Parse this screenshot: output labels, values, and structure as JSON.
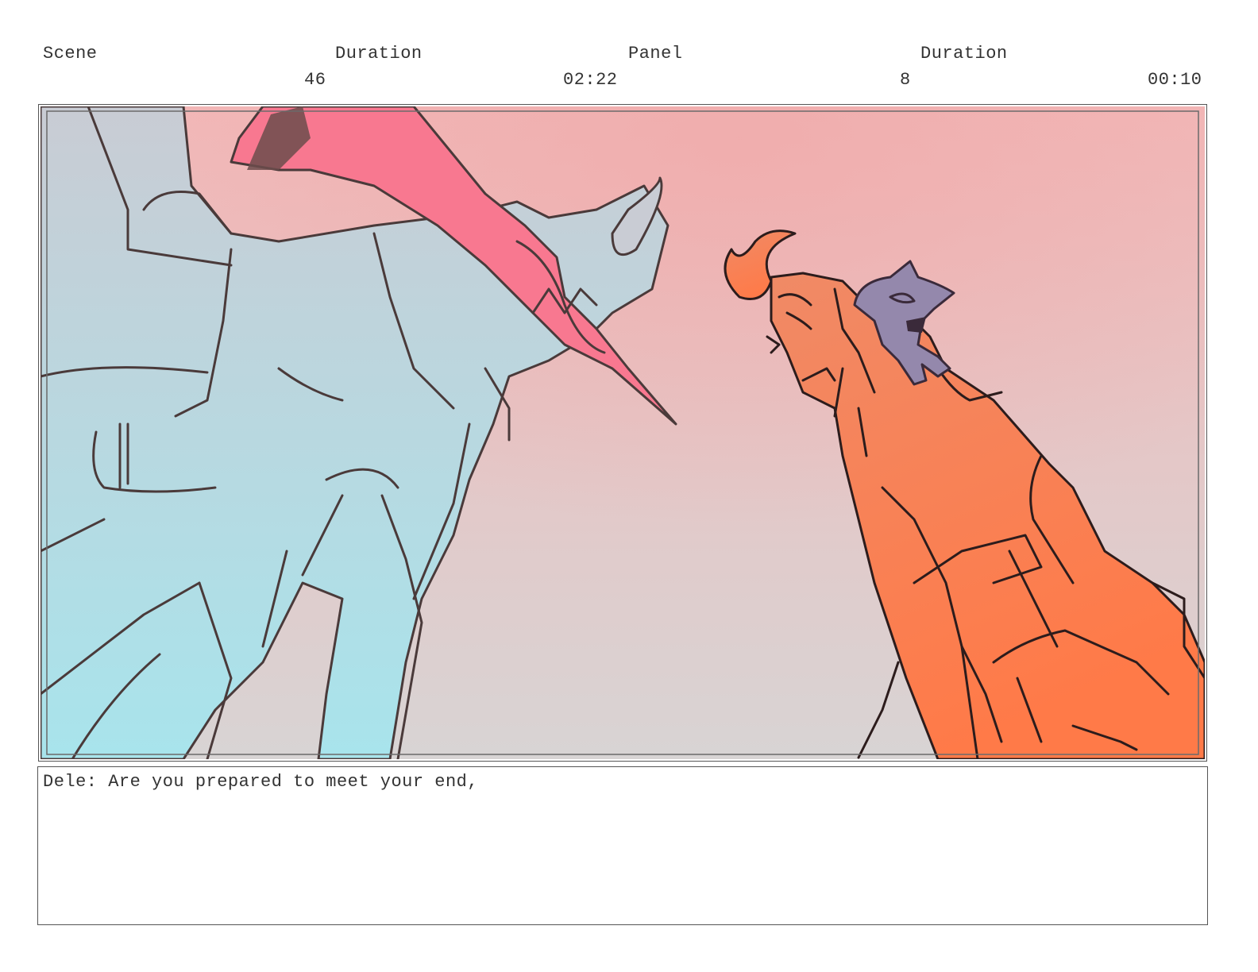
{
  "header": {
    "scene_label": "Scene",
    "scene_duration_label": "Duration",
    "panel_label": "Panel",
    "panel_duration_label": "Duration",
    "scene_number": "46",
    "scene_duration": "02:22",
    "panel_number": "8",
    "panel_duration": "00:10"
  },
  "panel_image": {
    "colors": {
      "sky_top": "#f2b9b9",
      "sky_bottom": "#d8d4d4",
      "left_figure_top": "#c9ccd4",
      "left_figure_bottom": "#a8e4ec",
      "left_figure_weapon": "#f87890",
      "right_figure_top": "#f08a66",
      "right_figure_bottom": "#ff7a48",
      "creature": "#9488ac",
      "line": "#4a3a3a"
    }
  },
  "dialogue": {
    "text": "Dele: Are you prepared to meet your end,"
  }
}
